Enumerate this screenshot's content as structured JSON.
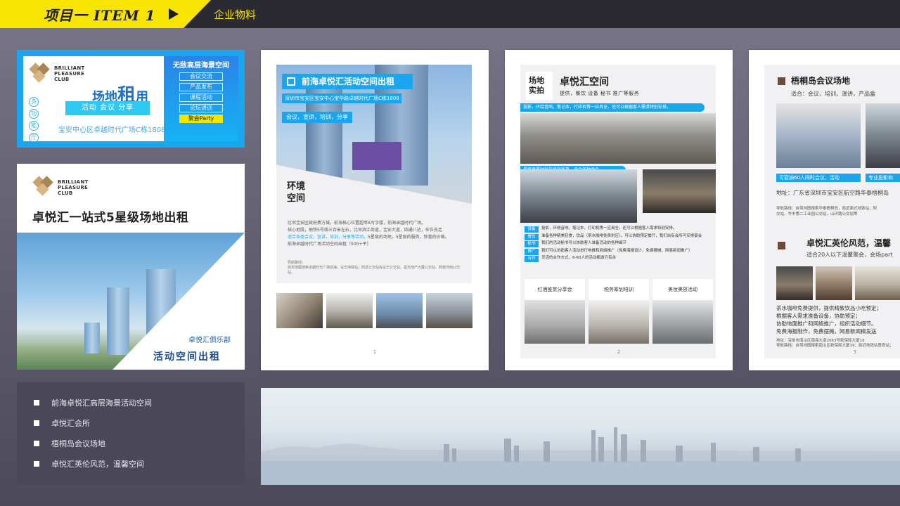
{
  "header": {
    "title": "项目一  ITEM 1",
    "subtitle": "企业物料",
    "accent_color": "#f7e400"
  },
  "brand": {
    "line1": "BRILLIANT",
    "line2": "PLEASURE",
    "line3": "CLUB"
  },
  "banner": {
    "title_prefix": "场地",
    "title_big": "租",
    "title_suffix": "用",
    "vertical_chars": [
      "多",
      "功",
      "能",
      "厅"
    ],
    "tags": "活动  会议  分享",
    "address": "宝安中心区卓越时代广场C栋1808",
    "side_title": "无敌高层海景空间",
    "side_items": [
      "会议交流",
      "产品发布",
      "课程活动",
      "论坛讲训",
      "聚会Party"
    ]
  },
  "left_card": {
    "title": "卓悦汇一站式5星级场地出租",
    "subtitle": "卓悦汇俱乐部",
    "rent_label": "活动空间出租"
  },
  "left_list": {
    "items": [
      "前海卓悦汇高层海景活动空间",
      "卓悦汇会所",
      "梧桐岛会议场地",
      "卓悦汇英伦风范，温馨空间"
    ]
  },
  "page1": {
    "title": "前海卓悦汇活动空间出租",
    "address": "深圳市宝安区宝安中心宝华路卓越时代广场C栋1808",
    "tags": "会议，宣讲，培训，分享",
    "env_label": "环境空间",
    "body_1": "比邻宝安区政府费方城，前海核心位置超甲A写字楼，前海卓越时代广场。",
    "body_2": "核心地段，地铁5号线三百米左右，比邻滨江商道，宝安大道，四通八达，车位充足",
    "body_3_hl": "适合各类会议，宣讲，培训，分享等活动，",
    "body_3_rest": "5星级的场地，5星级的服务，惊喜的价格。",
    "body_4": "前海卓越时代广场活动空间出租（500+平）",
    "note_title": "导航路线：",
    "note_text": "自驾地图搜索卓越时代广场前海，宝华地铁站；附近公交站有宝华公交站、盈光地产大厦公交站、熙苑湾西公交站。",
    "page_number": "1"
  },
  "page2": {
    "label": "场地实拍",
    "title": "卓悦汇空间",
    "sub": "提供，餐饮 设备 秘书 推广等服务",
    "bar1": "投影，环绕音响，笔记本，打印机等一应具全，还可以根据客人需求特别安排。",
    "bar2": "星级高雅时尚装修和家具，适合各种场合",
    "features": [
      {
        "tag": "设备",
        "text": "投影，环绕音响，笔记本，打印机等一应具全，还可以根据客人需求特别安排。"
      },
      {
        "tag": "餐饮",
        "text": "准备各种精美轻食，饮品（茶水咖啡免费供应）。可以协助预定餐厅，我们自有会所可安排宴会"
      },
      {
        "tag": "秘书",
        "text": "我们的活动秘书可以协助客人准备活动的各种细节"
      },
      {
        "tag": "推广",
        "text": "我们可以协助客人活动进行地推和网络推广（免费海报设计，免费摆摊，网易新闻推广）"
      },
      {
        "tag": "合作",
        "text": "灵活的合作方式，6-60人的活动都游刃有余"
      }
    ],
    "captions": [
      "红酒鉴赏分享会",
      "税务筹划培训",
      "美妆美容活动"
    ],
    "page_number": "2"
  },
  "page3": {
    "title1": "梧桐岛会议场地",
    "suit1": "适合：会议，培训，演讲，产品盒",
    "cap1": "可容纳60人同时会议、活动",
    "cap2": "专业投影和",
    "address": "地址：广东省深圳市宝安区航空路华泰梧桐岛",
    "nav1": "导航路线：自驾地图搜索华泰梧桐岛，临近面式地铁站；附",
    "nav2": "交站、华丰第二工业园公交站、山环路公交站等",
    "title2": "卓悦汇英伦风范，温馨",
    "suit2": "适合20人以下温馨聚会，会场part",
    "desc1": "茶水咖啡免费提供，提供精致饮品小吃预定；",
    "desc2": "根据客人需求准备设备，协助预定；",
    "desc3": "协助地面推广和网络推广，组织活动细节。",
    "desc4": "免费海报制作，免费摆摊，网易新闻稿发送",
    "addr2": "地址：深圳市南山区南海大道2063号新保辉大厦19",
    "nav3": "导航路线：自驾地图搜索南山区新保辉大厦19；临近地铁站登良站；",
    "page_number": "3"
  },
  "colors": {
    "brand_blue": "#1aa5ef",
    "dark": "#2b2a33",
    "panel_dark": "#4a4759"
  }
}
